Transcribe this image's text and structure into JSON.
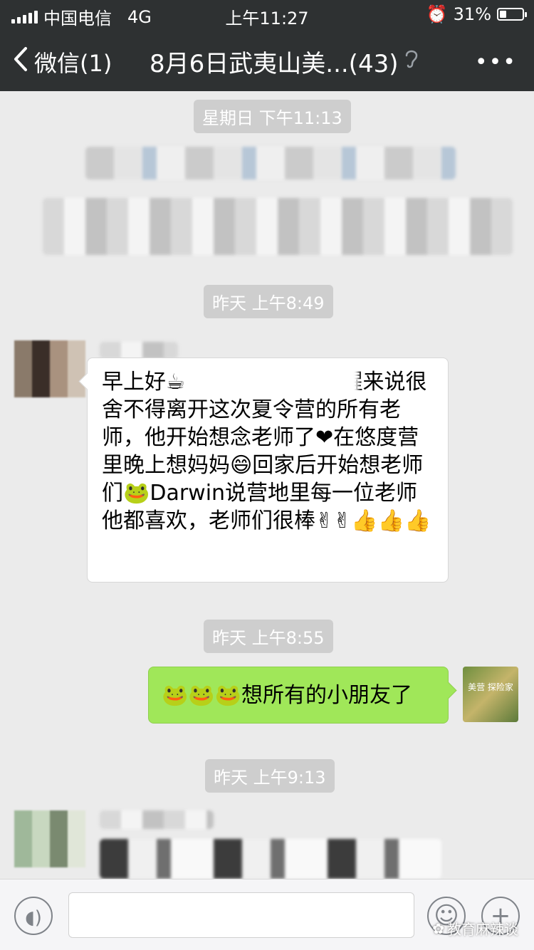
{
  "status_bar": {
    "carrier": "中国电信",
    "network": "4G",
    "time": "上午11:27",
    "battery_percent": "31%",
    "battery_level": 0.31
  },
  "nav": {
    "back_label": "微信(1)",
    "title": "8月6日武夷山美...(43)",
    "more_label": "•••"
  },
  "messages": {
    "time1": "星期日 下午11:13",
    "time2": "昨天 上午8:49",
    "msg1_text": "早上好☕          rwin早上醒来说很舍不得离开这次夏令营的所有老师，他开始想念老师了❤在悠度营里晚上想妈妈😄回家后开始想老师们🐸Darwin说营地里每一位老师他都喜欢，老师们很棒✌✌👍👍👍",
    "time3": "昨天 上午8:55",
    "msg2_text": "🐸🐸🐸想所有的小朋友了",
    "self_avatar_text": "美营 探险家",
    "time4": "昨天 上午9:13"
  },
  "input_bar": {
    "voice_icon": "voice-icon",
    "emoji_icon": "emoji-icon",
    "plus_icon": "plus-icon",
    "watermark": "教育麻辣谈"
  },
  "colors": {
    "bar_bg": "#2e3132",
    "chat_bg": "#ebebeb",
    "self_bubble": "#a0e759"
  }
}
